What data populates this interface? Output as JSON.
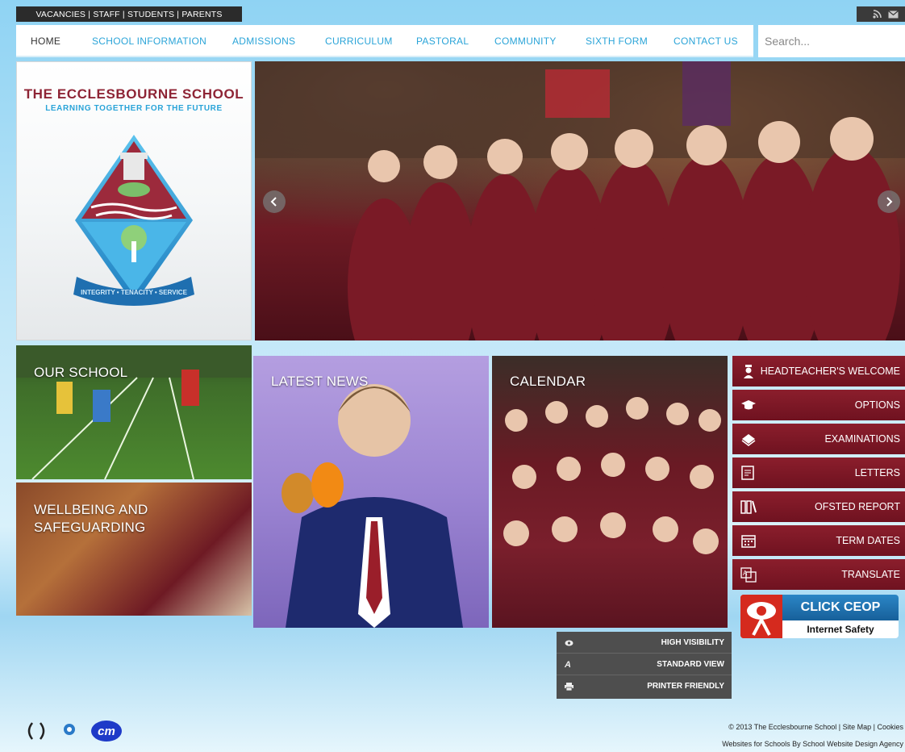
{
  "topbar": {
    "links": [
      "VACANCIES",
      "STAFF",
      "STUDENTS",
      "PARENTS"
    ],
    "separator": " | "
  },
  "nav": {
    "items": [
      "HOME",
      "SCHOOL INFORMATION",
      "ADMISSIONS",
      "CURRICULUM",
      "PASTORAL",
      "COMMUNITY",
      "SIXTH FORM",
      "CONTACT US"
    ]
  },
  "search": {
    "placeholder": "Search..."
  },
  "logo": {
    "school_name": "THE ECCLESBOURNE SCHOOL",
    "motto": "LEARNING TOGETHER FOR THE FUTURE",
    "crest_banner": "INTEGRITY • TENACITY • SERVICE"
  },
  "tiles": {
    "our_school": "OUR SCHOOL",
    "wellbeing_line1": "WELLBEING AND",
    "wellbeing_line2": "SAFEGUARDING",
    "latest_news": "LATEST NEWS",
    "calendar": "CALENDAR"
  },
  "quick_links": [
    {
      "label": "HEADTEACHER'S WELCOME",
      "icon": "headteacher-icon"
    },
    {
      "label": "OPTIONS",
      "icon": "graduation-cap-icon"
    },
    {
      "label": "EXAMINATIONS",
      "icon": "book-icon"
    },
    {
      "label": "LETTERS",
      "icon": "letter-icon"
    },
    {
      "label": "OFSTED REPORT",
      "icon": "report-icon"
    },
    {
      "label": "TERM DATES",
      "icon": "calendar-icon"
    },
    {
      "label": "TRANSLATE",
      "icon": "translate-icon"
    }
  ],
  "ceop": {
    "title": "CLICK CEOP",
    "subtitle": "Internet Safety"
  },
  "accessibility": [
    {
      "label": "HIGH VISIBILITY",
      "icon": "eye-icon"
    },
    {
      "label": "STANDARD VIEW",
      "icon": "font-icon"
    },
    {
      "label": "PRINTER FRIENDLY",
      "icon": "printer-icon"
    }
  ],
  "footer": {
    "copyright": "© 2013 The Ecclesbourne School | Site Map | Cookies",
    "credit": "Websites for Schools By School Website Design Agency"
  },
  "colors": {
    "maroon": "#8b1e2c",
    "blue": "#2aa4d8",
    "dark": "#2b2b2b"
  }
}
